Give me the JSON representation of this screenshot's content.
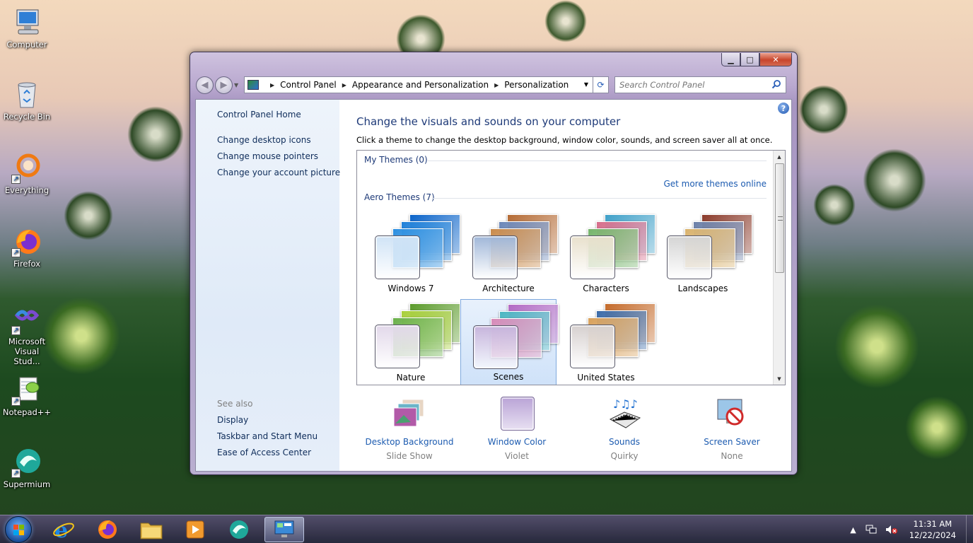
{
  "desktop": {
    "icons": [
      {
        "label": "Computer",
        "icon": "computer-icon"
      },
      {
        "label": "Recycle Bin",
        "icon": "recycle-bin-icon"
      },
      {
        "label": "Everything",
        "icon": "everything-search-icon"
      },
      {
        "label": "Firefox",
        "icon": "firefox-icon"
      },
      {
        "label": "Microsoft Visual Stud...",
        "icon": "visual-studio-icon"
      },
      {
        "label": "Notepad++",
        "icon": "notepad-plus-plus-icon"
      },
      {
        "label": "Supermium",
        "icon": "supermium-icon"
      }
    ]
  },
  "window": {
    "caption_buttons": {
      "minimize": "▁",
      "maximize": "□",
      "close": "✕"
    },
    "nav": {
      "back": "◀",
      "forward": "▶",
      "dropdown": "▼"
    },
    "breadcrumb": [
      "Control Panel",
      "Appearance and Personalization",
      "Personalization"
    ],
    "breadcrumb_separator": "▶",
    "refresh": "⟳",
    "search_placeholder": "Search Control Panel"
  },
  "left_pane": {
    "home_link": "Control Panel Home",
    "links": [
      "Change desktop icons",
      "Change mouse pointers",
      "Change your account picture"
    ],
    "see_also_heading": "See also",
    "see_also_links": [
      "Display",
      "Taskbar and Start Menu",
      "Ease of Access Center"
    ]
  },
  "main": {
    "help": "?",
    "title": "Change the visuals and sounds on your computer",
    "description": "Click a theme to change the desktop background, window color, sounds, and screen saver all at once.",
    "my_themes_heading": "My Themes (0)",
    "get_more_link": "Get more themes online",
    "aero_themes_heading": "Aero Themes (7)",
    "themes": [
      {
        "name": "Windows 7",
        "selected": false,
        "swatch": "#cfe3f6",
        "colors": [
          "#0a63c9",
          "#1d7fd8",
          "#2a8ee0"
        ]
      },
      {
        "name": "Architecture",
        "selected": false,
        "swatch": "#9fb6d8",
        "colors": [
          "#b46a34",
          "#6a86b8",
          "#c98a4a"
        ]
      },
      {
        "name": "Characters",
        "selected": false,
        "swatch": "#e8e0cc",
        "colors": [
          "#3fa0c8",
          "#d66c8a",
          "#74b46a"
        ]
      },
      {
        "name": "Landscapes",
        "selected": false,
        "swatch": "#d4d4d4",
        "colors": [
          "#8a3a2a",
          "#6a7fa8",
          "#d9b26c"
        ]
      },
      {
        "name": "Nature",
        "selected": false,
        "swatch": "#e2d8ea",
        "colors": [
          "#5a9a2a",
          "#a8cf3a",
          "#6ab04a"
        ]
      },
      {
        "name": "Scenes",
        "selected": true,
        "swatch": "#c6b4dc",
        "colors": [
          "#b26ac4",
          "#4ab6c2",
          "#d68ab8"
        ]
      },
      {
        "name": "United States",
        "selected": false,
        "swatch": "#d6d0cf",
        "colors": [
          "#c46a2a",
          "#3a6aa8",
          "#d8a05a"
        ]
      }
    ],
    "bottom_items": [
      {
        "label": "Desktop Background",
        "value": "Slide Show",
        "icon": "desktop-background-icon"
      },
      {
        "label": "Window Color",
        "value": "Violet",
        "icon": "window-color-icon",
        "color": "#b9a3d6"
      },
      {
        "label": "Sounds",
        "value": "Quirky",
        "icon": "sounds-icon"
      },
      {
        "label": "Screen Saver",
        "value": "None",
        "icon": "screen-saver-icon"
      }
    ]
  },
  "taskbar": {
    "apps": [
      "internet-explorer-icon",
      "firefox-icon",
      "file-explorer-icon",
      "media-player-icon",
      "supermium-icon",
      "control-panel-icon"
    ],
    "active_app": "control-panel-icon",
    "tray_arrow": "▲",
    "time": "11:31 AM",
    "date": "12/22/2024"
  }
}
